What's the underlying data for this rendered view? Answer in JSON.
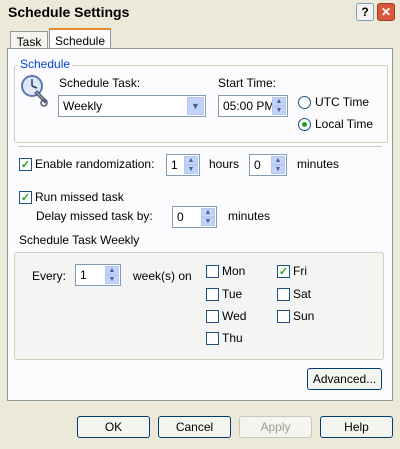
{
  "window": {
    "title": "Schedule Settings",
    "help_label": "?",
    "close_label": "✕"
  },
  "tabs": [
    {
      "label": "Task"
    },
    {
      "label": "Schedule"
    }
  ],
  "schedule": {
    "group_label": "Schedule",
    "task_label": "Schedule Task:",
    "task_value": "Weekly",
    "start_time_label": "Start Time:",
    "start_time_value": "05:00 PM",
    "utc_label": "UTC Time",
    "local_label": "Local Time",
    "selected_time_mode": "Local Time"
  },
  "randomization": {
    "label": "Enable randomization:",
    "checked": true,
    "hours_value": "1",
    "hours_label": "hours",
    "minutes_value": "0",
    "minutes_label": "minutes"
  },
  "missed": {
    "label": "Run missed task",
    "checked": true,
    "delay_label": "Delay missed task by:",
    "delay_value": "0",
    "delay_unit": "minutes"
  },
  "weekly": {
    "group_label": "Schedule Task Weekly",
    "every_label": "Every:",
    "every_value": "1",
    "unit_label": "week(s) on",
    "days": [
      {
        "label": "Mon",
        "checked": false
      },
      {
        "label": "Tue",
        "checked": false
      },
      {
        "label": "Wed",
        "checked": false
      },
      {
        "label": "Thu",
        "checked": false
      },
      {
        "label": "Fri",
        "checked": true
      },
      {
        "label": "Sat",
        "checked": false
      },
      {
        "label": "Sun",
        "checked": false
      }
    ]
  },
  "advanced_label": "Advanced...",
  "buttons": {
    "ok": "OK",
    "cancel": "Cancel",
    "apply": "Apply",
    "help": "Help"
  },
  "icons": {
    "schedule_task": "clock-wrench-icon",
    "dropdown": "chevron-down-icon",
    "spin_up": "spin-up-icon",
    "spin_down": "spin-down-icon"
  },
  "colors": {
    "accent": "#0046d5",
    "tab_highlight": "#e68b2c",
    "check": "#21a121"
  }
}
